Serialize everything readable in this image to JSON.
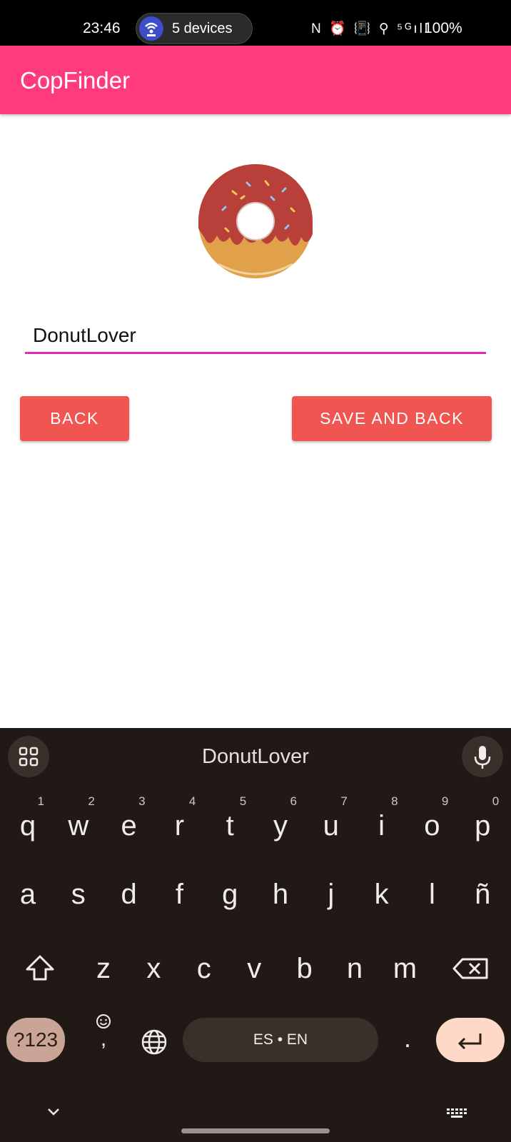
{
  "status_bar": {
    "time": "23:46",
    "hotspot_label": "5 devices",
    "icons_text": "N ⏰ 📳 ⚲ ⁵ᴳıll",
    "battery": "100%"
  },
  "app_bar": {
    "title": "CopFinder",
    "color": "#ff3b7d"
  },
  "avatar": {
    "icon": "donut-avatar"
  },
  "username_field": {
    "value": "DonutLover"
  },
  "buttons": {
    "back": "BACK",
    "save": "SAVE AND BACK",
    "color": "#f05551"
  },
  "keyboard": {
    "suggestion": "DonutLover",
    "row1": [
      {
        "k": "q",
        "n": "1"
      },
      {
        "k": "w",
        "n": "2"
      },
      {
        "k": "e",
        "n": "3"
      },
      {
        "k": "r",
        "n": "4"
      },
      {
        "k": "t",
        "n": "5"
      },
      {
        "k": "y",
        "n": "6"
      },
      {
        "k": "u",
        "n": "7"
      },
      {
        "k": "i",
        "n": "8"
      },
      {
        "k": "o",
        "n": "9"
      },
      {
        "k": "p",
        "n": "0"
      }
    ],
    "row2": [
      "a",
      "s",
      "d",
      "f",
      "g",
      "h",
      "j",
      "k",
      "l",
      "ñ"
    ],
    "row3": [
      "z",
      "x",
      "c",
      "v",
      "b",
      "n",
      "m"
    ],
    "symbols_label": "?123",
    "space_label": "ES • EN",
    "period": ".",
    "comma": ","
  }
}
